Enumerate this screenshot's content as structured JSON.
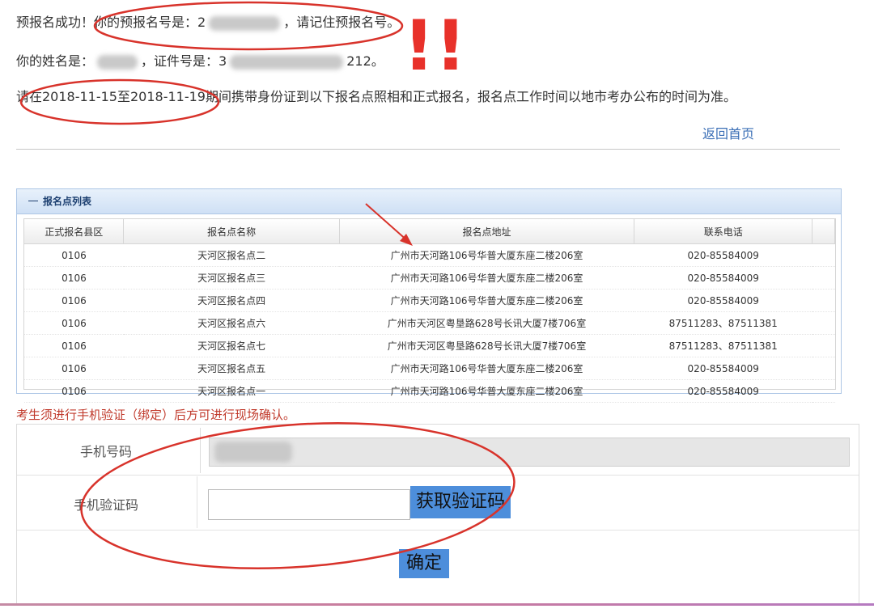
{
  "messages": {
    "success_prefix": "预报名成功！你的预报名号是：2",
    "success_suffix": "，请记住预报名号。",
    "name_prefix": "你的姓名是：",
    "id_prefix": "，证件号是：3",
    "id_suffix": "212。",
    "notice": "请在2018-11-15至2018-11-19期间携带身份证到以下报名点照相和正式报名，报名点工作时间以地市考办公布的时间为准。"
  },
  "back_link": "返回首页",
  "panel": {
    "title": "报名点列表",
    "columns": [
      "正式报名县区",
      "报名点名称",
      "报名点地址",
      "联系电话"
    ],
    "rows": [
      [
        "0106",
        "天河区报名点二",
        "广州市天河路106号华普大厦东座二楼206室",
        "020-85584009"
      ],
      [
        "0106",
        "天河区报名点三",
        "广州市天河路106号华普大厦东座二楼206室",
        "020-85584009"
      ],
      [
        "0106",
        "天河区报名点四",
        "广州市天河路106号华普大厦东座二楼206室",
        "020-85584009"
      ],
      [
        "0106",
        "天河区报名点六",
        "广州市天河区粤垦路628号长讯大厦7楼706室",
        "87511283、87511381"
      ],
      [
        "0106",
        "天河区报名点七",
        "广州市天河区粤垦路628号长讯大厦7楼706室",
        "87511283、87511381"
      ],
      [
        "0106",
        "天河区报名点五",
        "广州市天河路106号华普大厦东座二楼206室",
        "020-85584009"
      ],
      [
        "0106",
        "天河区报名点一",
        "广州市天河路106号华普大厦东座二楼206室",
        "020-85584009"
      ]
    ]
  },
  "warning": "考生须进行手机验证（绑定）后方可进行现场确认。",
  "form": {
    "phone_label": "手机号码",
    "code_label": "手机验证码",
    "get_code_button": "获取验证码",
    "confirm_button": "确定",
    "code_value": ""
  },
  "annotations": {
    "exclaim": "!!",
    "color": "#e8312a"
  }
}
